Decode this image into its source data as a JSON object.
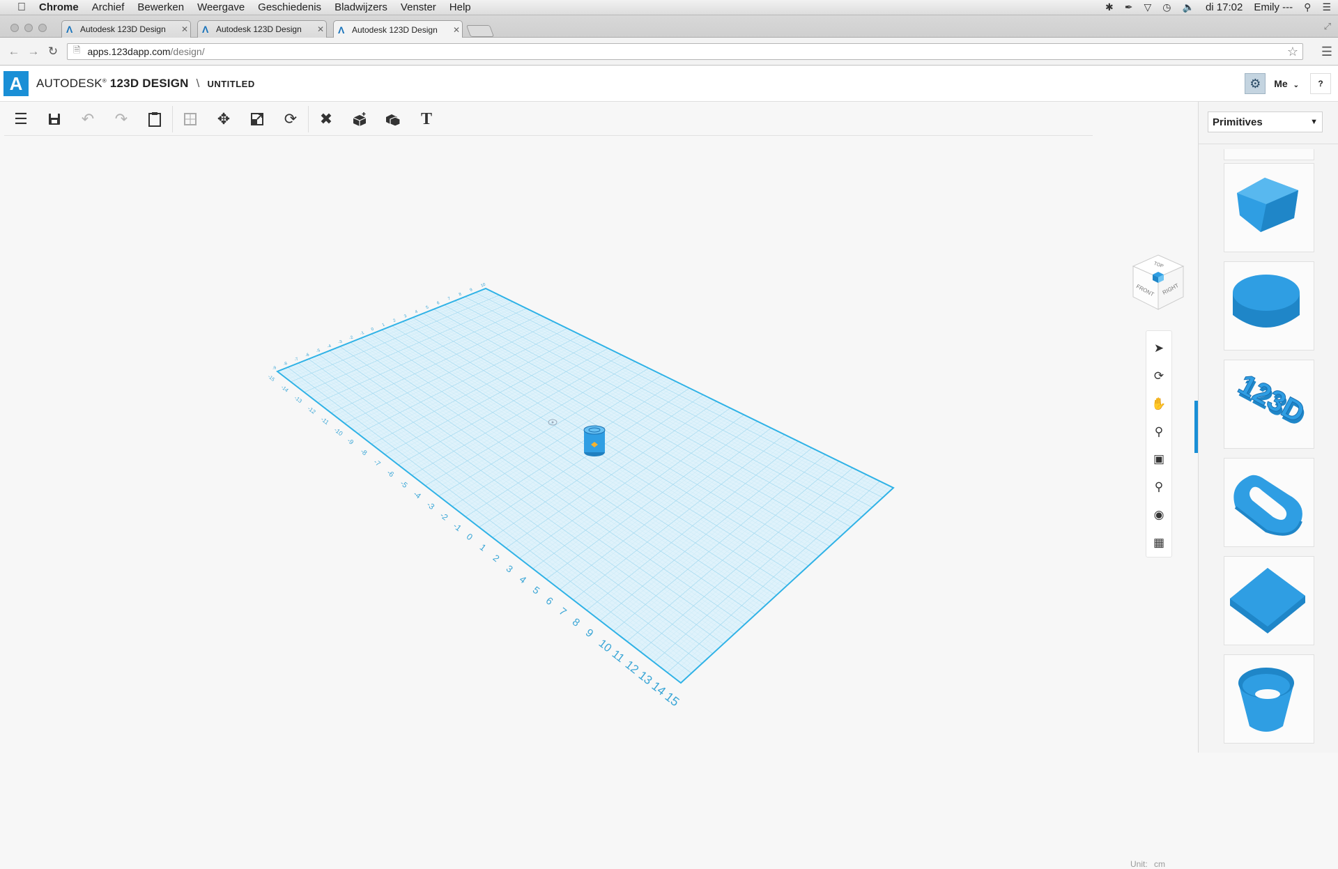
{
  "macos": {
    "apple_symbol": "",
    "menu": [
      "Chrome",
      "Archief",
      "Bewerken",
      "Weergave",
      "Geschiedenis",
      "Bladwijzers",
      "Venster",
      "Help"
    ],
    "clock": "di 17:02",
    "user": "Emily ---"
  },
  "browser": {
    "tabs": [
      {
        "title": "Autodesk 123D Design",
        "active": false
      },
      {
        "title": "Autodesk 123D Design",
        "active": false
      },
      {
        "title": "Autodesk 123D Design",
        "active": true
      }
    ],
    "url_host": "apps.123dapp.com",
    "url_path": "/design/"
  },
  "app": {
    "logo_letter": "A",
    "brand_regular": "AUTODESK",
    "brand_reg_mark": "®",
    "brand_bold": "123D",
    "brand_product": "DESIGN",
    "separator": "\\",
    "document_name": "UNTITLED",
    "user_menu": "Me",
    "help": "?",
    "accent": "#1a8fd6"
  },
  "toolbar": {
    "tools": [
      "menu-icon",
      "save-icon",
      "undo-icon",
      "redo-icon",
      "clipboard-icon",
      "select-box-icon",
      "move-icon",
      "scale-icon",
      "refresh-icon",
      "modify-icon",
      "primitive-box-icon",
      "combine-icon",
      "text-icon"
    ]
  },
  "viewcube": {
    "top": "TOP",
    "front": "FRONT",
    "right": "RIGHT"
  },
  "grid": {
    "front_axis_labels": [
      "-15",
      "-14",
      "-13",
      "-12",
      "-11",
      "-10",
      "-9",
      "-8",
      "-7",
      "-6",
      "-5",
      "-4",
      "-3",
      "-2",
      "-1",
      "0",
      "1",
      "2",
      "3",
      "4",
      "5",
      "6",
      "7",
      "8",
      "9",
      "10",
      "11",
      "12",
      "13",
      "14",
      "15"
    ],
    "left_axis_labels": [
      "-9",
      "-8",
      "-7",
      "-6",
      "-5",
      "-4",
      "-3",
      "-2",
      "-1",
      "0",
      "1",
      "2",
      "3",
      "4",
      "5",
      "6",
      "7",
      "8",
      "9",
      "10"
    ]
  },
  "unit": {
    "label": "Unit:",
    "value": "cm"
  },
  "panel": {
    "library": "Primitives",
    "shapes": [
      "box",
      "cylinder",
      "text-3d",
      "torus",
      "flat-box",
      "hollow-cone"
    ],
    "shape_3d_text": "123D",
    "shape_color": "#2f9ee3"
  }
}
